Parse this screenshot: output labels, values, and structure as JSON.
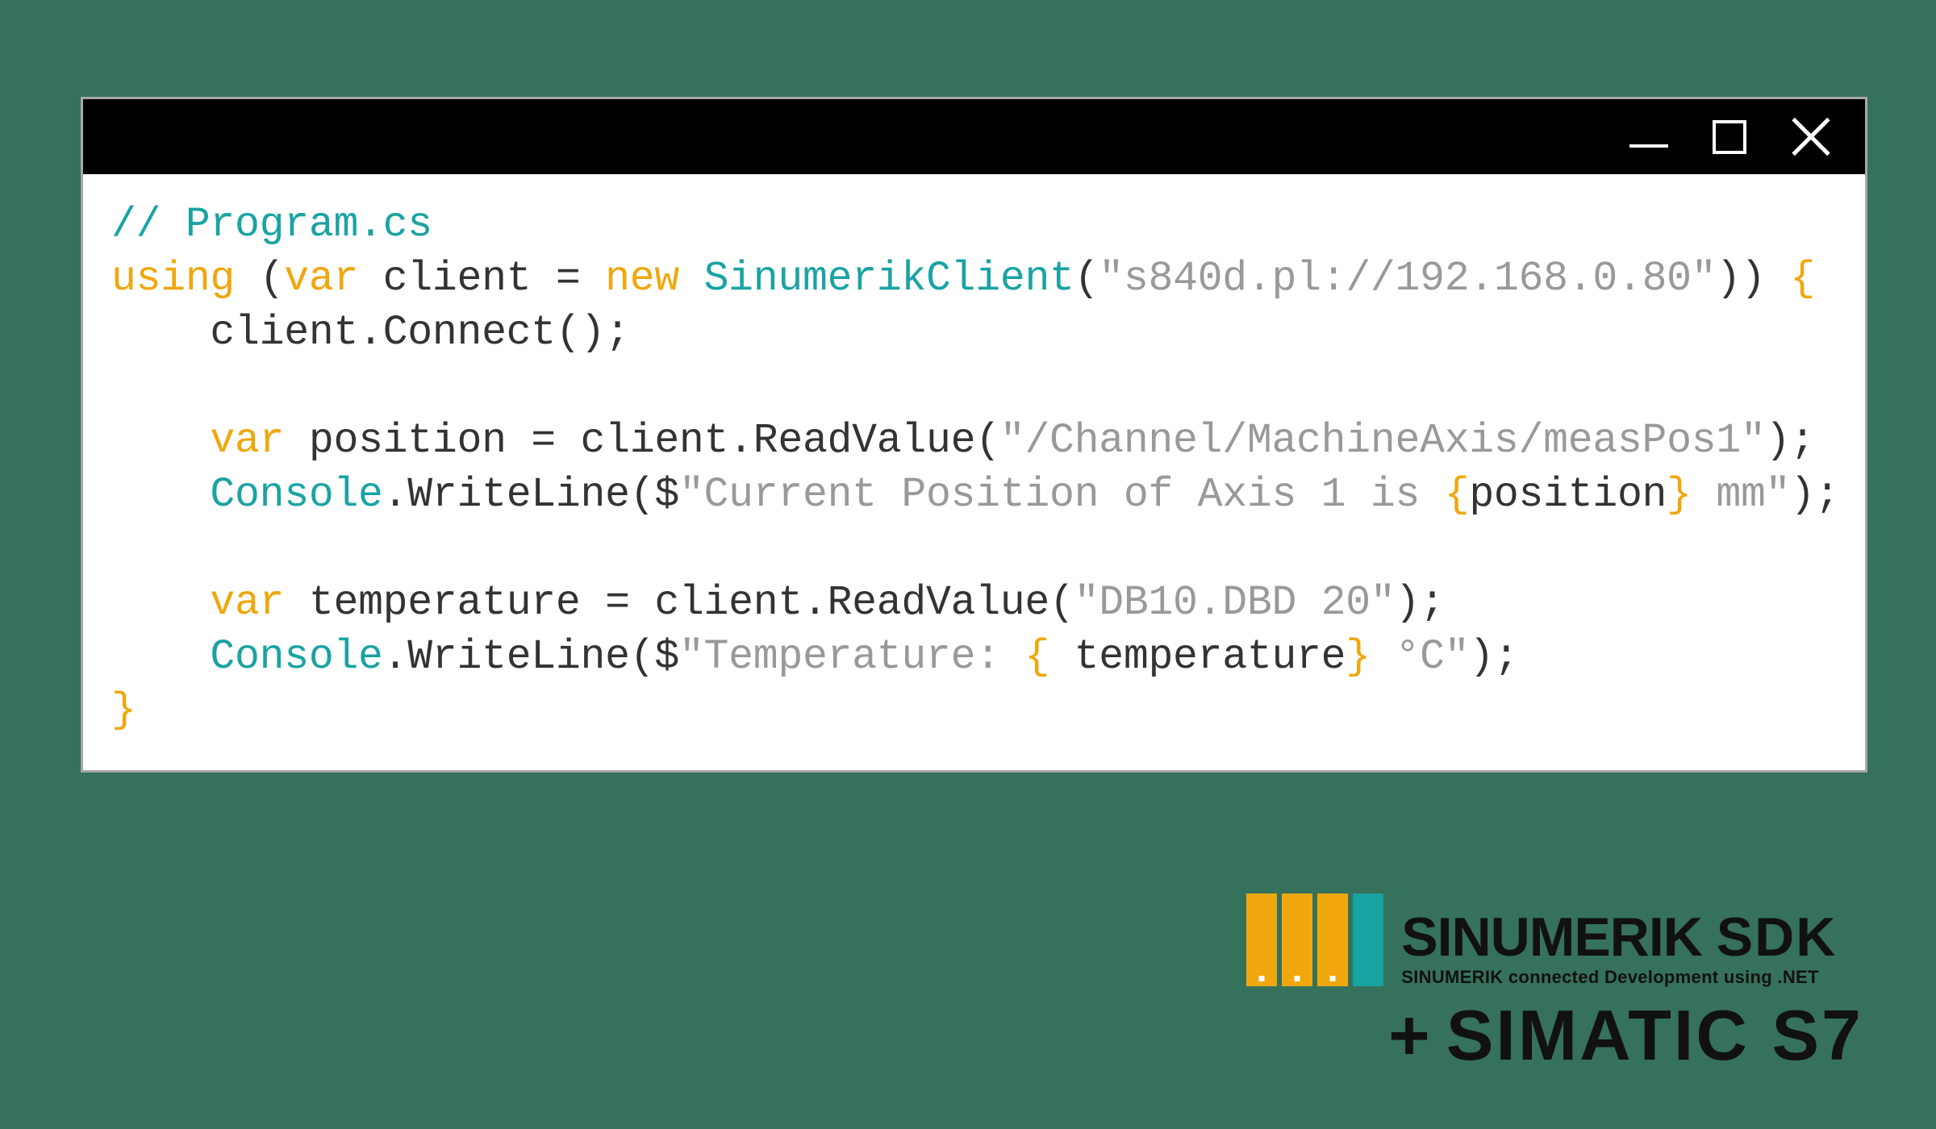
{
  "titlebar": {
    "title": ""
  },
  "code": {
    "l1_comment": "// Program.cs",
    "l2_using": "using",
    "l2_paren1": " (",
    "l2_var": "var",
    "l2_client_eq": " client = ",
    "l2_new": "new",
    "l2_space": " ",
    "l2_type": "SinumerikClient",
    "l2_paren2": "(",
    "l2_str": "\"s840d.pl://192.168.0.80\"",
    "l2_paren3": ")) ",
    "l2_brace": "{",
    "l3": "    client.Connect();",
    "l5_indent": "    ",
    "l5_var": "var",
    "l5_rest": " position = client.ReadValue(",
    "l5_str": "\"/Channel/MachineAxis/measPos1\"",
    "l5_end": ");",
    "l6_indent": "    ",
    "l6_console": "Console",
    "l6_dot": ".WriteLine($",
    "l6_str1": "\"Current Position of Axis 1 is ",
    "l6_brace1": "{",
    "l6_pos": "position",
    "l6_brace2": "}",
    "l6_str2": " mm\"",
    "l6_end": ");",
    "l8_indent": "    ",
    "l8_var": "var",
    "l8_rest": " temperature = client.ReadValue(",
    "l8_str": "\"DB10.DBD 20\"",
    "l8_end": ");",
    "l9_indent": "    ",
    "l9_console": "Console",
    "l9_dot": ".WriteLine($",
    "l9_str1": "\"Temperature: ",
    "l9_brace1": "{",
    "l9_tmp": " temperature",
    "l9_brace2": "}",
    "l9_str2": " °C\"",
    "l9_end": ");",
    "l10_brace": "}"
  },
  "branding": {
    "main": "SINUMERIK ",
    "sdk": "SDK",
    "sub": "SINUMERIK connected Development using .NET",
    "plus": "+",
    "simatic": "SIMATIC S7"
  }
}
